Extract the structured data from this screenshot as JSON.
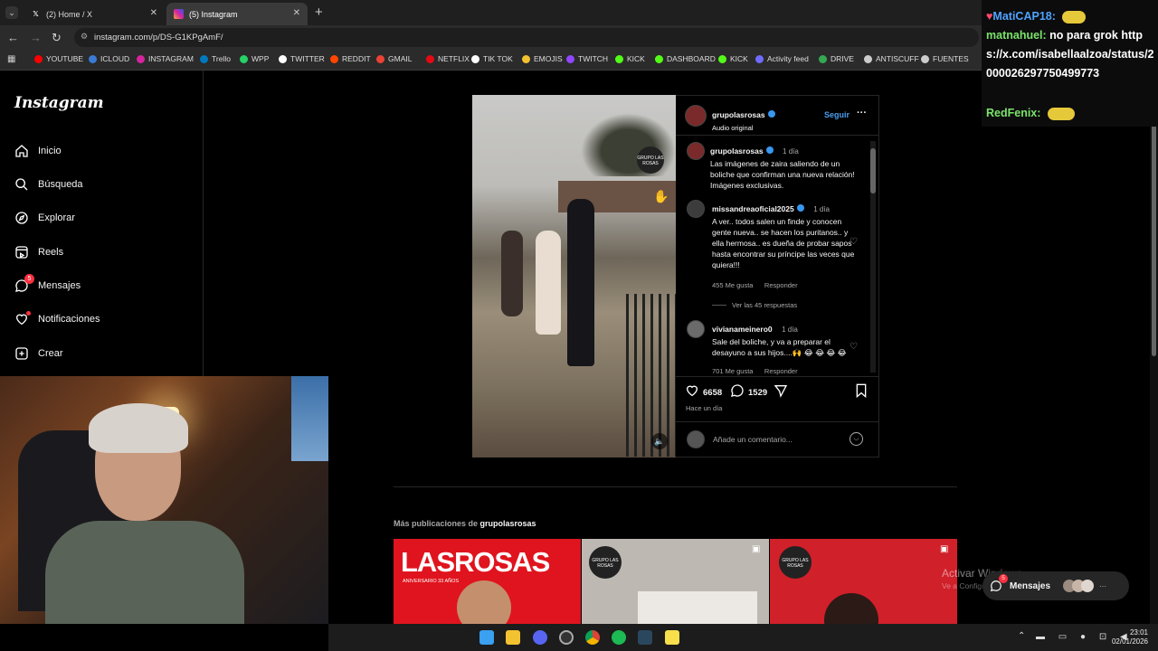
{
  "browser": {
    "tabs": [
      {
        "label": "(2) Home / X",
        "active": false
      },
      {
        "label": "(5) Instagram",
        "active": true
      }
    ],
    "new_tab": "+",
    "url": "instagram.com/p/DS-G1KPgAmF/",
    "bookmarks": [
      "YOUTUBE",
      "ICLOUD",
      "INSTAGRAM",
      "Trello",
      "WPP",
      "TWITTER",
      "REDDIT",
      "GMAIL",
      "NETFLIX",
      "TIK TOK",
      "EMOJIS",
      "TWITCH",
      "KICK",
      "DASHBOARD",
      "KICK",
      "Activity feed",
      "DRIVE",
      "ANTISCUFF",
      "FUENTES"
    ]
  },
  "instagram": {
    "logo": "Instagram",
    "nav": [
      {
        "label": "Inicio",
        "icon": "home-icon"
      },
      {
        "label": "Búsqueda",
        "icon": "search-icon"
      },
      {
        "label": "Explorar",
        "icon": "compass-icon"
      },
      {
        "label": "Reels",
        "icon": "reels-icon"
      },
      {
        "label": "Mensajes",
        "icon": "messenger-icon",
        "badge": "5"
      },
      {
        "label": "Notificaciones",
        "icon": "heart-icon"
      },
      {
        "label": "Crear",
        "icon": "plus-square-icon"
      }
    ],
    "post": {
      "username": "grupolasrosas",
      "subtitle": "Audio original",
      "follow": "Seguir",
      "more": "···",
      "watermark": "GRUPO LAS ROSAS",
      "caption": {
        "user": "grupolasrosas",
        "time": "1 día",
        "text": "Las imágenes de zaira saliendo de un boliche que confirman una nueva relación! Imágenes exclusivas."
      },
      "comments": [
        {
          "user": "missandreaoficial2025",
          "time": "1 día",
          "text": "A ver.. todos salen un finde y conocen gente nueva.. se hacen los puritanos.. y ella hermosa.. es dueña de probar sapos hasta encontrar su príncipe las veces que quiera!!!",
          "likes": "455 Me gusta",
          "reply": "Responder",
          "view_replies": "Ver las 45 respuestas"
        },
        {
          "user": "vivianameinero0",
          "time": "1 día",
          "text": "Sale del boliche, y va a preparar el desayuno a sus hijos....🙌 😂 😂 😂 😂",
          "likes": "701 Me gusta",
          "reply": "Responder"
        }
      ],
      "like_count": "6658",
      "comment_count": "1529",
      "posted": "Hace un día",
      "add_comment_placeholder": "Añade un comentario..."
    },
    "more_posts_prefix": "Más publicaciones de",
    "more_posts_user": "grupolasrosas",
    "thumb_title": "LASROSAS",
    "thumb_subtitle": "ANIVERSARIO 33 AÑOS",
    "thumb_badge": "GRUPO LAS ROSAS",
    "messages_bubble": "Mensajes",
    "messages_badge": "5"
  },
  "chat": [
    {
      "user": "MatiCAP18:",
      "text": "",
      "color": "#4ea3ff"
    },
    {
      "user": "matnahuel:",
      "text": "no para grok https://x.com/isabellaalzoa/status/2000026297750499773",
      "color": "#7be36b"
    },
    {
      "user": "RedFenix:",
      "text": "",
      "color": "#7be36b"
    }
  ],
  "watermark": {
    "title": "Activar Windows",
    "subtitle": "Ve a Configuración para activar Windows."
  },
  "clock": {
    "time": "23:01",
    "date": "02/01/2026"
  }
}
